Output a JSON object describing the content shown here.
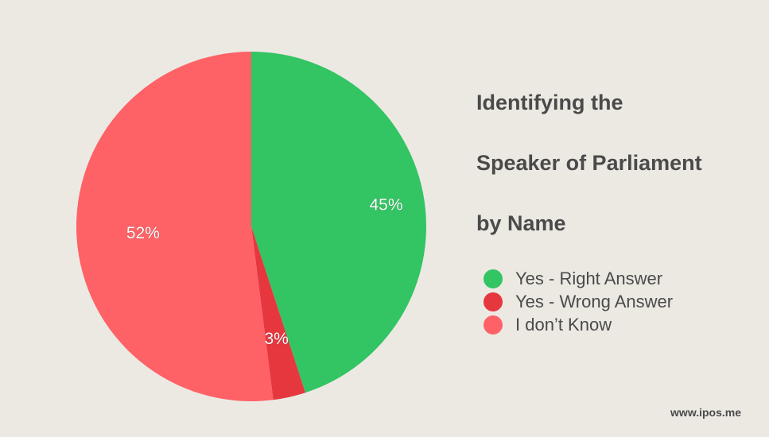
{
  "chart_data": {
    "type": "pie",
    "title": "Identifying the Speaker of Parliament by Name",
    "categories": [
      "Yes - Right Answer",
      "Yes - Wrong Answer",
      "I don’t Know"
    ],
    "values": [
      45,
      3,
      52
    ],
    "labels": [
      "45%",
      "3%",
      "52%"
    ],
    "colors": [
      "#33c463",
      "#e6373f",
      "#fe6266"
    ],
    "legend_position": "right"
  },
  "title_lines": [
    "Identifying the",
    "Speaker of Parliament",
    "by Name"
  ],
  "legend": [
    {
      "label": "Yes - Right Answer",
      "color": "#33c463"
    },
    {
      "label": "Yes - Wrong Answer",
      "color": "#e6373f"
    },
    {
      "label": "I don’t Know",
      "color": "#fe6266"
    }
  ],
  "watermark": "www.ipos.me"
}
